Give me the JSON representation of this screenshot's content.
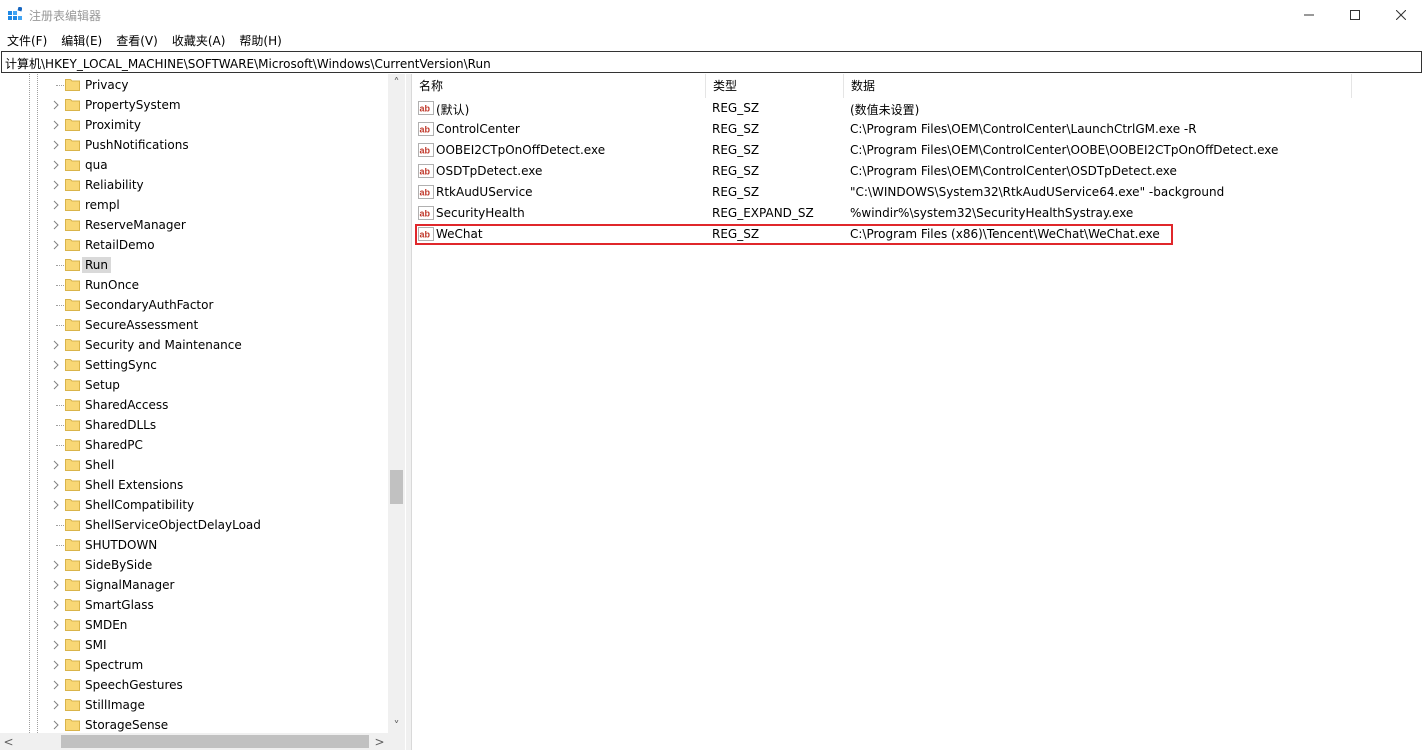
{
  "window": {
    "title": "注册表编辑器",
    "buttons": {
      "minimize": "—",
      "maximize": "☐",
      "close": "✕"
    }
  },
  "menu": [
    "文件(F)",
    "编辑(E)",
    "查看(V)",
    "收藏夹(A)",
    "帮助(H)"
  ],
  "address": "计算机\\HKEY_LOCAL_MACHINE\\SOFTWARE\\Microsoft\\Windows\\CurrentVersion\\Run",
  "tree": {
    "items": [
      {
        "label": "Privacy",
        "expandable": false
      },
      {
        "label": "PropertySystem",
        "expandable": true
      },
      {
        "label": "Proximity",
        "expandable": true
      },
      {
        "label": "PushNotifications",
        "expandable": true
      },
      {
        "label": "qua",
        "expandable": true
      },
      {
        "label": "Reliability",
        "expandable": true
      },
      {
        "label": "rempl",
        "expandable": true
      },
      {
        "label": "ReserveManager",
        "expandable": true
      },
      {
        "label": "RetailDemo",
        "expandable": true
      },
      {
        "label": "Run",
        "expandable": false,
        "selected": true
      },
      {
        "label": "RunOnce",
        "expandable": false
      },
      {
        "label": "SecondaryAuthFactor",
        "expandable": false
      },
      {
        "label": "SecureAssessment",
        "expandable": false
      },
      {
        "label": "Security and Maintenance",
        "expandable": true
      },
      {
        "label": "SettingSync",
        "expandable": true
      },
      {
        "label": "Setup",
        "expandable": true
      },
      {
        "label": "SharedAccess",
        "expandable": false
      },
      {
        "label": "SharedDLLs",
        "expandable": false
      },
      {
        "label": "SharedPC",
        "expandable": false
      },
      {
        "label": "Shell",
        "expandable": true
      },
      {
        "label": "Shell Extensions",
        "expandable": true
      },
      {
        "label": "ShellCompatibility",
        "expandable": true
      },
      {
        "label": "ShellServiceObjectDelayLoad",
        "expandable": false
      },
      {
        "label": "SHUTDOWN",
        "expandable": false
      },
      {
        "label": "SideBySide",
        "expandable": true
      },
      {
        "label": "SignalManager",
        "expandable": true
      },
      {
        "label": "SmartGlass",
        "expandable": true
      },
      {
        "label": "SMDEn",
        "expandable": true
      },
      {
        "label": "SMI",
        "expandable": true
      },
      {
        "label": "Spectrum",
        "expandable": true
      },
      {
        "label": "SpeechGestures",
        "expandable": true
      },
      {
        "label": "StillImage",
        "expandable": true
      },
      {
        "label": "StorageSense",
        "expandable": true
      }
    ],
    "scroll_up": "˄",
    "scroll_down": "˅",
    "scroll_left": "<",
    "scroll_right": ">"
  },
  "list": {
    "columns": {
      "name": "名称",
      "type": "类型",
      "data": "数据"
    },
    "rows": [
      {
        "name": "(默认)",
        "type": "REG_SZ",
        "data": "(数值未设置)"
      },
      {
        "name": "ControlCenter",
        "type": "REG_SZ",
        "data": "C:\\Program Files\\OEM\\ControlCenter\\LaunchCtrlGM.exe -R"
      },
      {
        "name": "OOBEI2CTpOnOffDetect.exe",
        "type": "REG_SZ",
        "data": "C:\\Program Files\\OEM\\ControlCenter\\OOBE\\OOBEI2CTpOnOffDetect.exe"
      },
      {
        "name": "OSDTpDetect.exe",
        "type": "REG_SZ",
        "data": "C:\\Program Files\\OEM\\ControlCenter\\OSDTpDetect.exe"
      },
      {
        "name": "RtkAudUService",
        "type": "REG_SZ",
        "data": "\"C:\\WINDOWS\\System32\\RtkAudUService64.exe\" -background"
      },
      {
        "name": "SecurityHealth",
        "type": "REG_EXPAND_SZ",
        "data": "%windir%\\system32\\SecurityHealthSystray.exe"
      },
      {
        "name": "WeChat",
        "type": "REG_SZ",
        "data": "C:\\Program Files (x86)\\Tencent\\WeChat\\WeChat.exe",
        "highlighted": true
      }
    ],
    "value_icon_text": "ab"
  },
  "colors": {
    "highlight_border": "#e0272b",
    "folder": "#f8d775",
    "selection": "#d9d9d9",
    "value_icon": "#c0392b"
  }
}
